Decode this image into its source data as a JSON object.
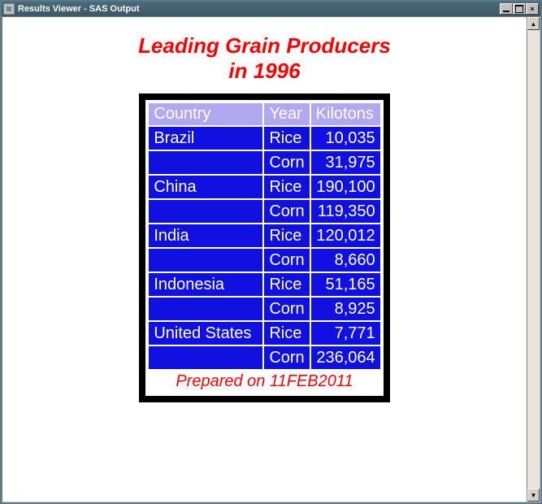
{
  "window": {
    "title": "Results Viewer - SAS Output"
  },
  "report": {
    "title_line1": "Leading Grain Producers",
    "title_line2": "in 1996",
    "footer": "Prepared on 11FEB2011"
  },
  "columns": {
    "country": "Country",
    "year": "Year",
    "kilotons": "Kilotons"
  },
  "rows": [
    {
      "country": "Brazil",
      "year": "Rice",
      "kilotons": "10,035"
    },
    {
      "country": "",
      "year": "Corn",
      "kilotons": "31,975"
    },
    {
      "country": "China",
      "year": "Rice",
      "kilotons": "190,100"
    },
    {
      "country": "",
      "year": "Corn",
      "kilotons": "119,350"
    },
    {
      "country": "India",
      "year": "Rice",
      "kilotons": "120,012"
    },
    {
      "country": "",
      "year": "Corn",
      "kilotons": "8,660"
    },
    {
      "country": "Indonesia",
      "year": "Rice",
      "kilotons": "51,165"
    },
    {
      "country": "",
      "year": "Corn",
      "kilotons": "8,925"
    },
    {
      "country": "United States",
      "year": "Rice",
      "kilotons": "7,771"
    },
    {
      "country": "",
      "year": "Corn",
      "kilotons": "236,064"
    }
  ]
}
